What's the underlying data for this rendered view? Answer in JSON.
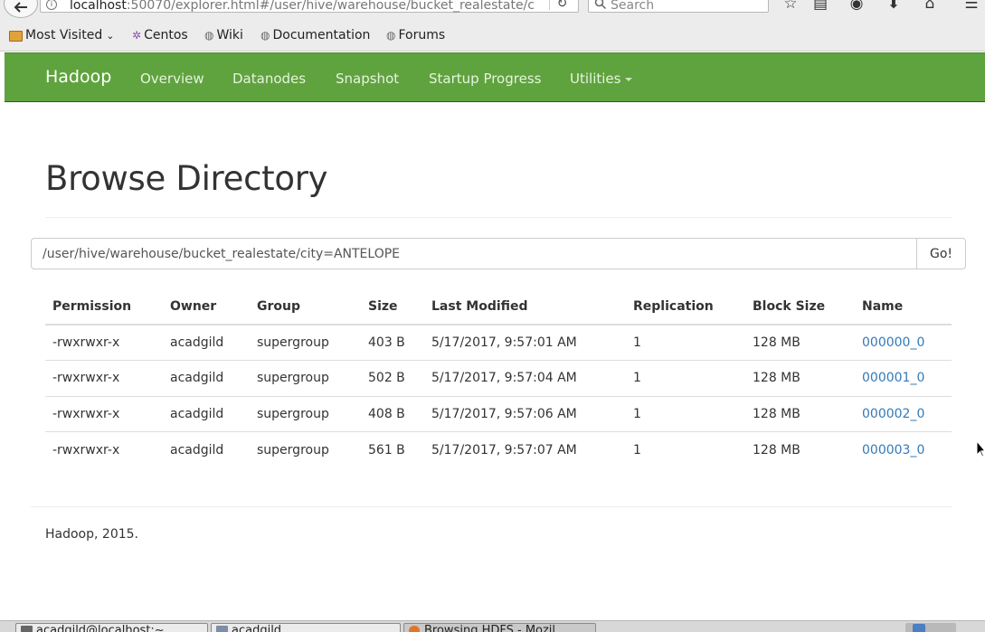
{
  "browser": {
    "url_prefix": "localhost",
    "url_rest": ":50070/explorer.html#/user/hive/warehouse/bucket_realestate/c",
    "search_placeholder": "Search",
    "bookmarks": [
      "Most Visited",
      "Centos",
      "Wiki",
      "Documentation",
      "Forums"
    ]
  },
  "navbar": {
    "brand": "Hadoop",
    "items": [
      "Overview",
      "Datanodes",
      "Snapshot",
      "Startup Progress",
      "Utilities"
    ]
  },
  "page": {
    "title": "Browse Directory",
    "path_value": "/user/hive/warehouse/bucket_realestate/city=ANTELOPE",
    "go_label": "Go!",
    "footer": "Hadoop, 2015."
  },
  "table": {
    "headers": [
      "Permission",
      "Owner",
      "Group",
      "Size",
      "Last Modified",
      "Replication",
      "Block Size",
      "Name"
    ],
    "rows": [
      [
        "-rwxrwxr-x",
        "acadgild",
        "supergroup",
        "403 B",
        "5/17/2017, 9:57:01 AM",
        "1",
        "128 MB",
        "000000_0"
      ],
      [
        "-rwxrwxr-x",
        "acadgild",
        "supergroup",
        "502 B",
        "5/17/2017, 9:57:04 AM",
        "1",
        "128 MB",
        "000001_0"
      ],
      [
        "-rwxrwxr-x",
        "acadgild",
        "supergroup",
        "408 B",
        "5/17/2017, 9:57:06 AM",
        "1",
        "128 MB",
        "000002_0"
      ],
      [
        "-rwxrwxr-x",
        "acadgild",
        "supergroup",
        "561 B",
        "5/17/2017, 9:57:07 AM",
        "1",
        "128 MB",
        "000003_0"
      ]
    ]
  },
  "taskbar": {
    "tasks": [
      "acadgild@localhost:~",
      "acadgild",
      "Browsing HDFS - Mozil"
    ]
  },
  "colors": {
    "navbar": "#5fa33e",
    "link": "#337ab7"
  }
}
